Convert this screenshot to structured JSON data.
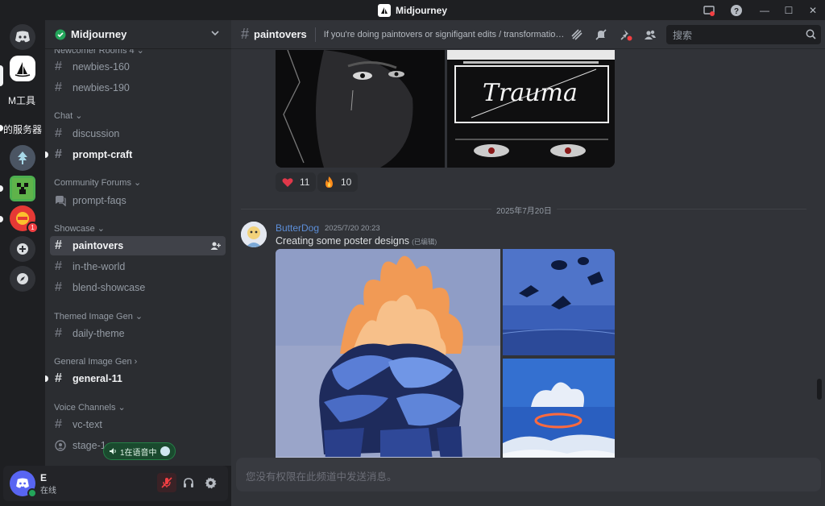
{
  "titlebar": {
    "app_title": "Midjourney"
  },
  "rail": {
    "servers": [
      {
        "label": "Direct messages",
        "icon": "discord-icon"
      },
      {
        "label": "Midjourney",
        "icon": "midjourney-icon"
      },
      {
        "label": "M工具"
      },
      {
        "label": "的服务器"
      },
      {
        "label": "Tree server",
        "icon": "tree-icon"
      },
      {
        "label": "Minecraft",
        "icon": "creeper-icon"
      },
      {
        "label": "Red server",
        "icon": "red-icon",
        "badge": "1"
      }
    ]
  },
  "guild": {
    "name": "Midjourney"
  },
  "sidebar": {
    "categories": {
      "newcomer": "Newcomer Rooms 4",
      "chat": "Chat",
      "forums": "Community Forums",
      "showcase": "Showcase",
      "themed": "Themed Image Gen",
      "general": "General Image Gen",
      "voice": "Voice Channels"
    },
    "channels": {
      "newbies160": "newbies-160",
      "newbies190": "newbies-190",
      "discussion": "discussion",
      "promptcraft": "prompt-craft",
      "promptfaqs": "prompt-faqs",
      "paintovers": "paintovers",
      "intheworld": "in-the-world",
      "blend": "blend-showcase",
      "daily": "daily-theme",
      "general11": "general-11",
      "vctext": "vc-text",
      "stage": "stage-1"
    },
    "voice_badge": "1在语音中"
  },
  "user": {
    "name": "E",
    "status": "在线"
  },
  "channel": {
    "name": "paintovers",
    "topic": "If you're doing paintovers or signifigant edits / transformations ...",
    "search_placeholder": "搜索"
  },
  "messages": {
    "reactions": [
      {
        "emoji": "heart",
        "count": "11"
      },
      {
        "emoji": "fire",
        "count": "10"
      }
    ],
    "date_divider": "2025年7月20日",
    "post": {
      "author": "ButterDog",
      "timestamp": "2025/7/20 20:23",
      "text": "Creating some poster designs",
      "edited": "(已编辑)"
    },
    "poster_text": "Trauma"
  },
  "composer": {
    "placeholder": "您没有权限在此频道中发送消息。"
  },
  "colors": {
    "accent": "#5865f2",
    "background": "#313338",
    "sidebar": "#2b2d31",
    "rail": "#1e1f22",
    "online": "#23a55a",
    "danger": "#f23f43",
    "author": "#5c8ed8"
  }
}
